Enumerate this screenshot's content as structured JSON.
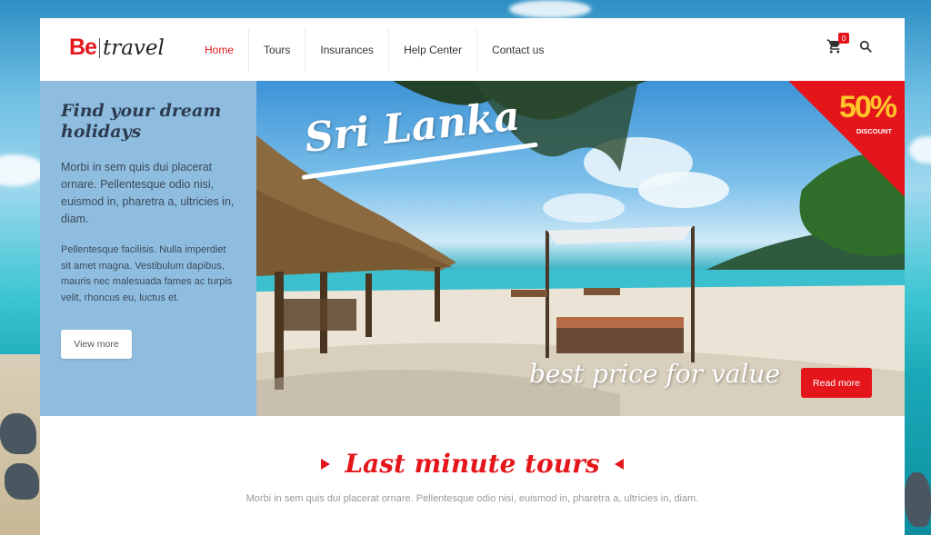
{
  "logo": {
    "be": "Be",
    "travel": "travel"
  },
  "nav": {
    "items": [
      {
        "label": "Home",
        "active": true
      },
      {
        "label": "Tours"
      },
      {
        "label": "Insurances"
      },
      {
        "label": "Help Center"
      },
      {
        "label": "Contact us"
      }
    ]
  },
  "header": {
    "cart_icon": "cart-icon",
    "cart_count": "0",
    "search_icon": "search-icon"
  },
  "hero": {
    "title": "Find your dream holidays",
    "paragraph1": "Morbi in sem quis dui placerat ornare. Pellentesque odio nisi, euismod in, pharetra a, ultricies in, diam.",
    "paragraph2": "Pellentesque facilisis. Nulla imperdiet sit amet magna. Vestibulum dapibus, mauris nec malesuada fames ac turpis velit, rhoncus eu, luctus et.",
    "view_more": "View more"
  },
  "promo": {
    "destination": "Sri Lanka",
    "discount_value": "50%",
    "discount_label": "DISCOUNT",
    "tagline": "best price for value",
    "read_more": "Read more"
  },
  "section": {
    "heading": "Last minute tours",
    "subtext": "Morbi in sem quis dui placerat ornare. Pellentesque odio nisi, euismod in, pharetra a, ultricies in, diam."
  },
  "colors": {
    "accent": "#e4161b",
    "sidebar": "#8fbde0",
    "discount_text": "#ffc52b"
  }
}
